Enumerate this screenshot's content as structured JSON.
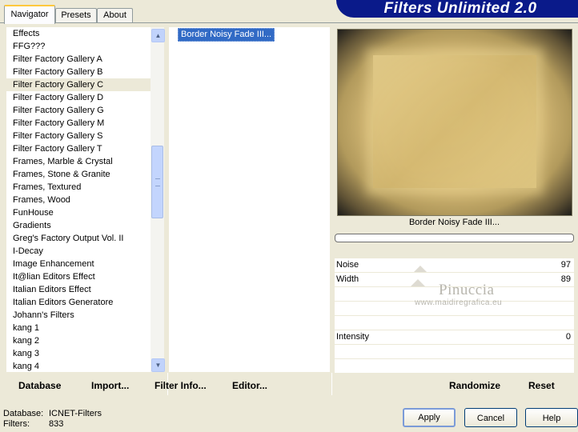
{
  "tabs": [
    {
      "label": "Navigator",
      "active": true
    },
    {
      "label": "Presets",
      "active": false
    },
    {
      "label": "About",
      "active": false
    }
  ],
  "banner": {
    "title": "Filters Unlimited 2.0"
  },
  "categories": {
    "items": [
      "Effects",
      "FFG???",
      "Filter Factory Gallery A",
      "Filter Factory Gallery B",
      "Filter Factory Gallery C",
      "Filter Factory Gallery D",
      "Filter Factory Gallery G",
      "Filter Factory Gallery M",
      "Filter Factory Gallery S",
      "Filter Factory Gallery T",
      "Frames, Marble & Crystal",
      "Frames, Stone & Granite",
      "Frames, Textured",
      "Frames, Wood",
      "FunHouse",
      "Gradients",
      "Greg's Factory Output Vol. II",
      "I-Decay",
      "Image Enhancement",
      "It@lian Editors Effect",
      "Italian Editors Effect",
      "Italian Editors Generatore",
      "Johann's Filters",
      "kang 1",
      "kang 2",
      "kang 3",
      "kang 4"
    ],
    "selected": "Filter Factory Gallery C"
  },
  "filters": {
    "items": [
      "Border Noisy Fade III..."
    ],
    "selected": "Border Noisy Fade III..."
  },
  "preview": {
    "filter_name": "Border Noisy Fade III..."
  },
  "params": [
    {
      "label": "Noise",
      "value": "97"
    },
    {
      "label": "Width",
      "value": "89"
    },
    {
      "label": "",
      "value": ""
    },
    {
      "label": "",
      "value": ""
    },
    {
      "label": "",
      "value": ""
    },
    {
      "label": "Intensity",
      "value": "0"
    },
    {
      "label": "",
      "value": ""
    },
    {
      "label": "",
      "value": ""
    }
  ],
  "watermark": {
    "name": "Pinuccia",
    "site": "www.maidiregrafica.eu"
  },
  "toolbar": {
    "database": "Database",
    "import": "Import...",
    "filter_info": "Filter Info...",
    "editor": "Editor...",
    "randomize": "Randomize",
    "reset": "Reset"
  },
  "status": {
    "database_label": "Database:",
    "database_value": "ICNET-Filters",
    "filters_label": "Filters:",
    "filters_value": "833"
  },
  "buttons": {
    "apply": "Apply",
    "cancel": "Cancel",
    "help": "Help"
  }
}
